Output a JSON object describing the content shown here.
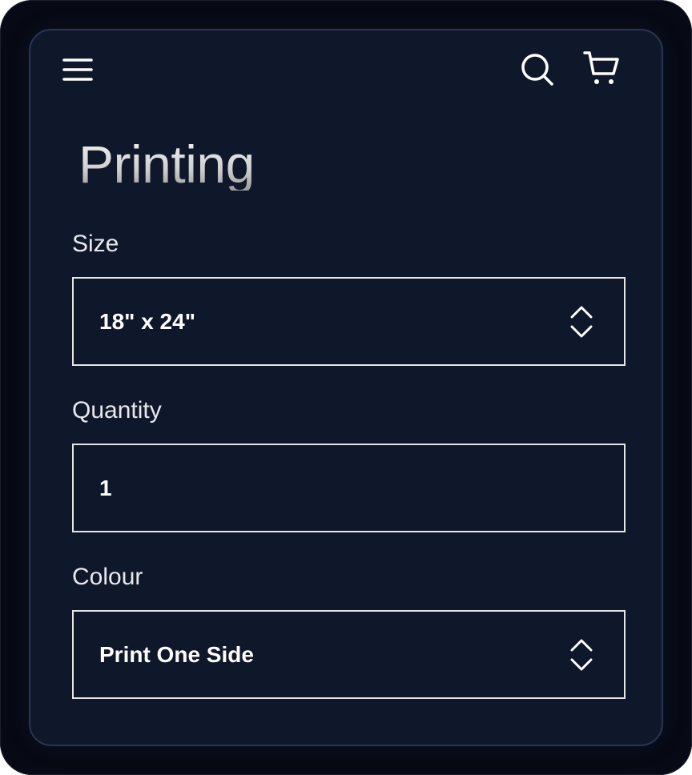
{
  "header": {
    "menu_icon": "menu-icon",
    "search_icon": "search-icon",
    "cart_icon": "cart-icon"
  },
  "page": {
    "title": "Printing"
  },
  "form": {
    "size": {
      "label": "Size",
      "value": "18\" x 24\""
    },
    "quantity": {
      "label": "Quantity",
      "value": "1"
    },
    "colour": {
      "label": "Colour",
      "value": "Print One Side"
    }
  },
  "colors": {
    "background": "#0f172a",
    "frame": "#070a14",
    "border": "#e6e6e6",
    "text": "#ffffff"
  }
}
